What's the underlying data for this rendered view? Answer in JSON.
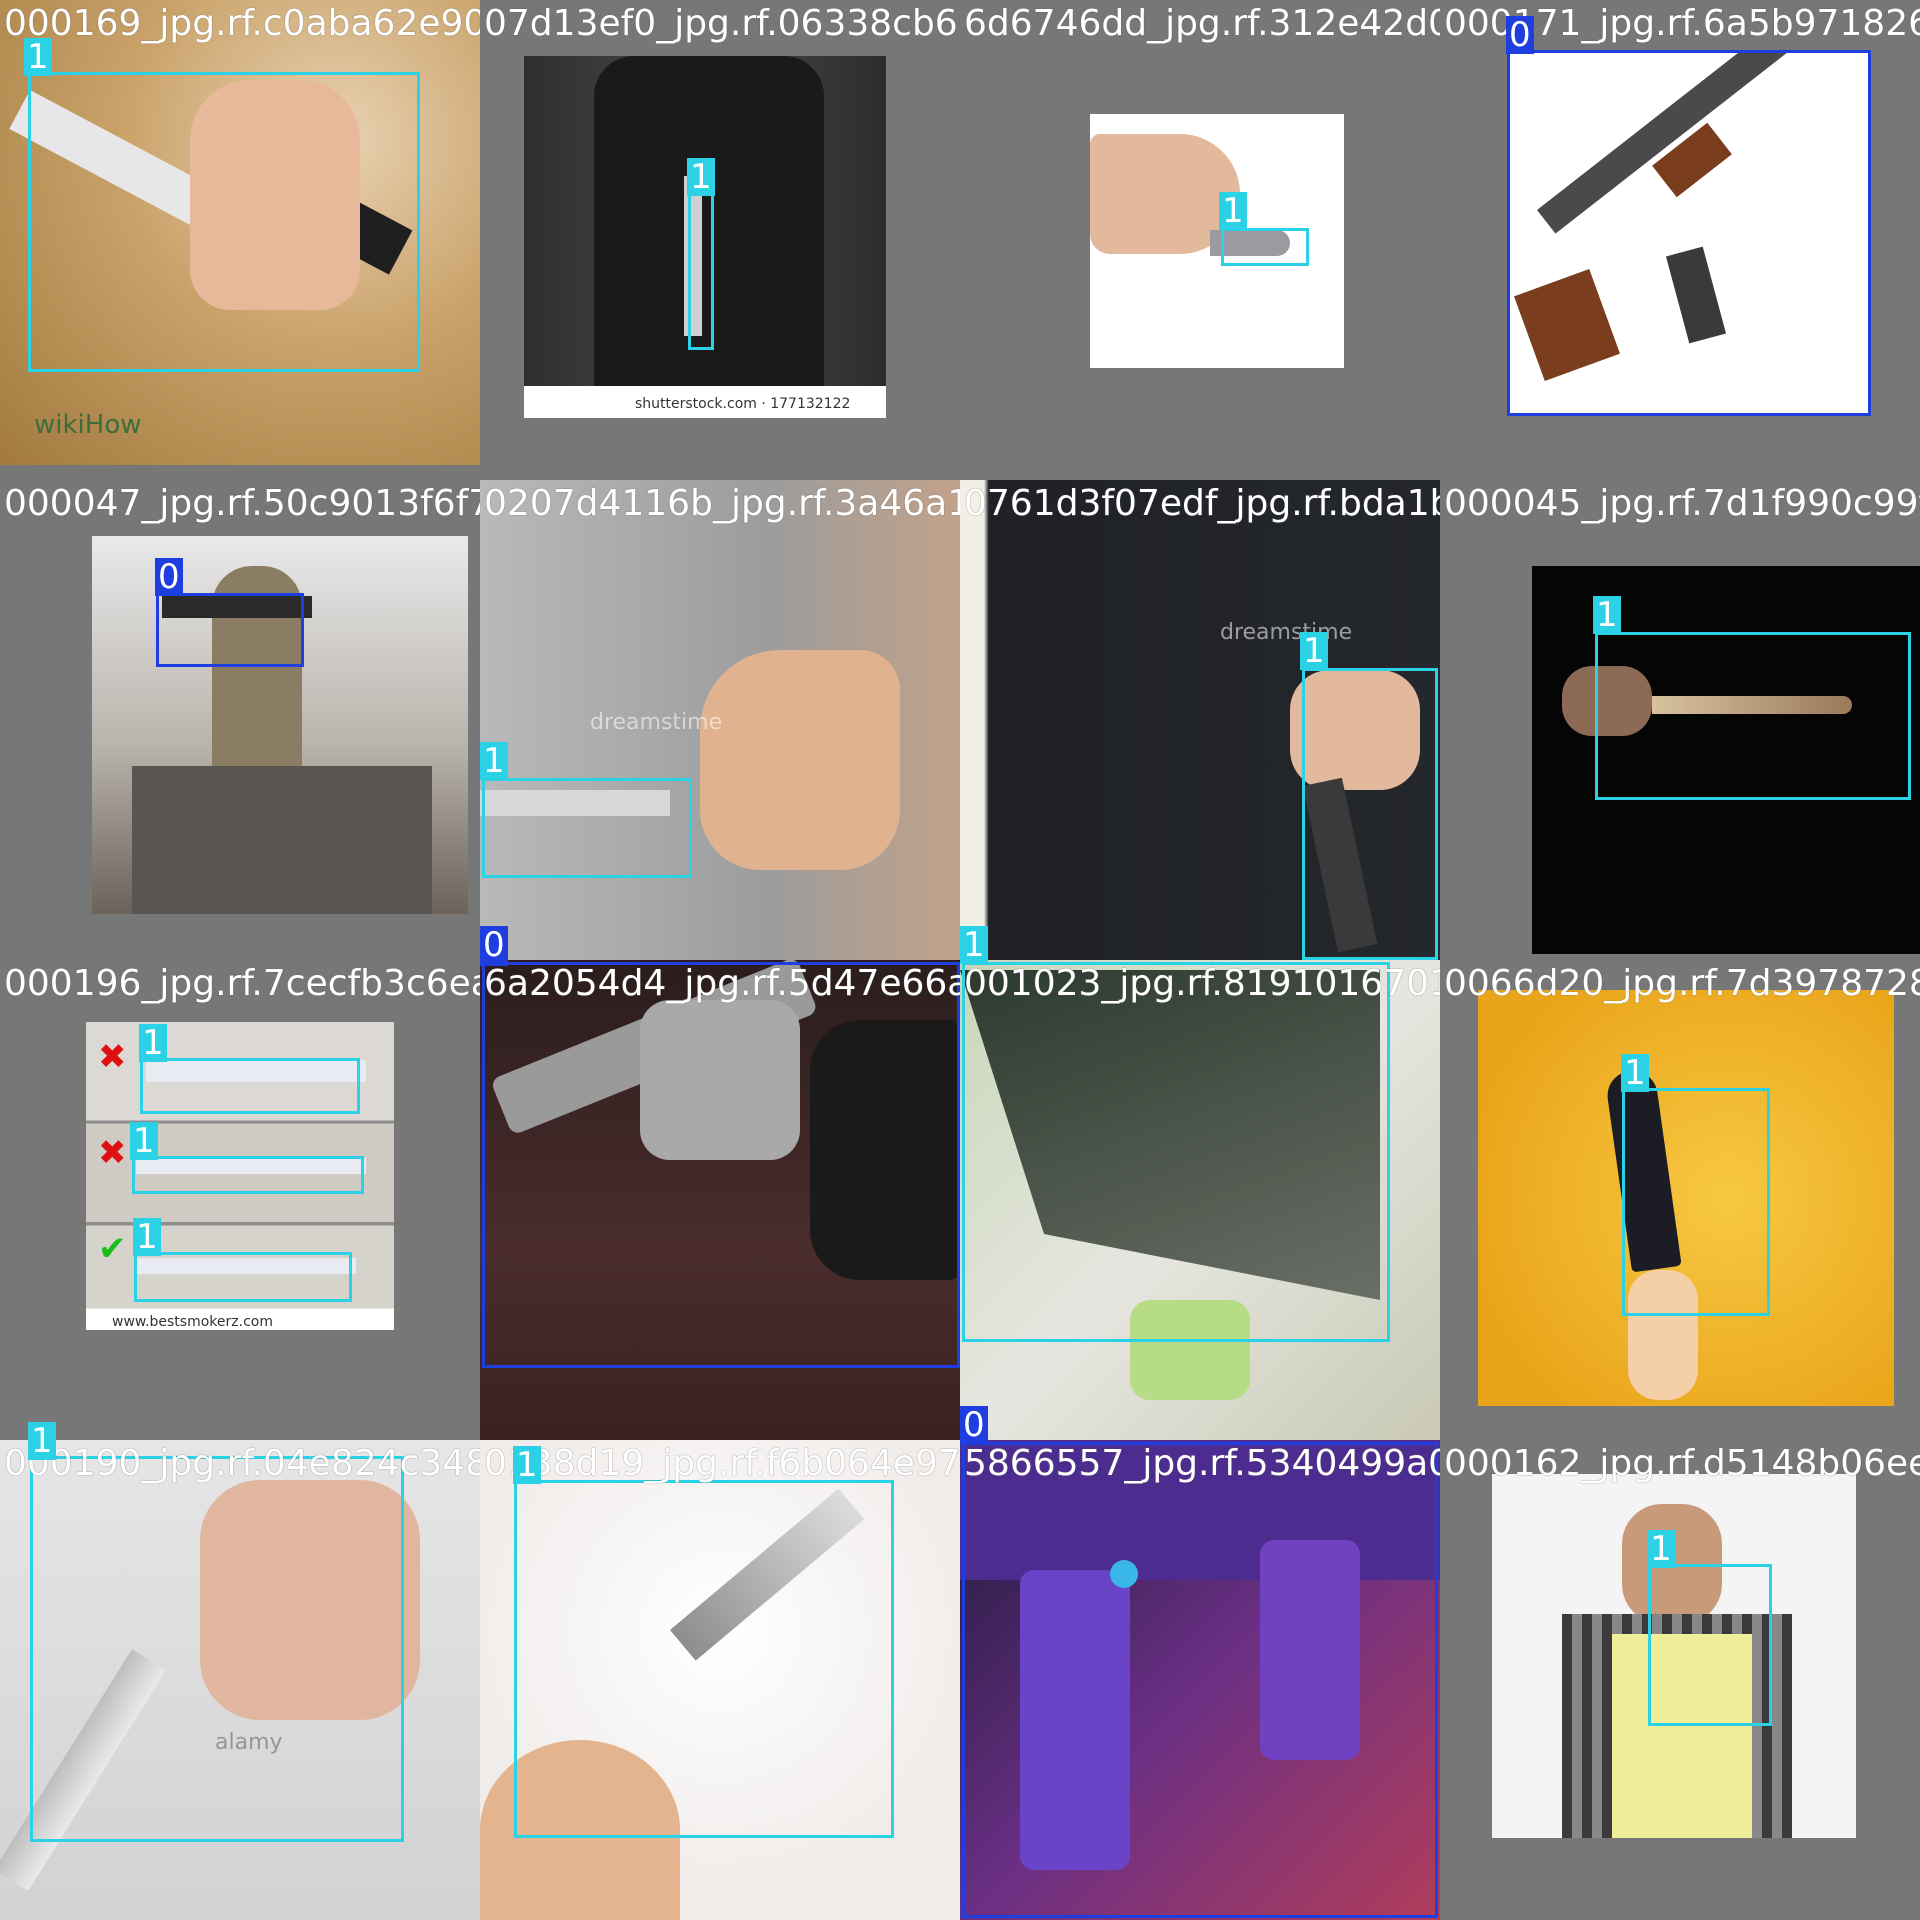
{
  "grid": {
    "tiles": [
      {
        "filename": "000169_jpg.rf.c0aba62e90f1",
        "labels": [
          "1"
        ],
        "watermark": "wikiHow"
      },
      {
        "filename": "07d13ef0_jpg.rf.06338cb60fb2",
        "labels": [
          "1"
        ],
        "caption": "shutterstock.com · 177132122"
      },
      {
        "filename": "6d6746dd_jpg.rf.312e42d0e585",
        "labels": [
          "1"
        ]
      },
      {
        "filename": "000171_jpg.rf.6a5b971826e",
        "labels": [
          "0"
        ]
      },
      {
        "filename": "000047_jpg.rf.50c9013f6f76",
        "labels": [
          "0"
        ]
      },
      {
        "filename": "0207d4116b_jpg.rf.3a46a17d4e",
        "labels": [
          "1"
        ],
        "watermark": "dreamstime"
      },
      {
        "filename": "0761d3f07edf_jpg.rf.bda1bd4eea",
        "labels": [
          "1"
        ],
        "watermark": "dreamstime"
      },
      {
        "filename": "000045_jpg.rf.7d1f990c99f625",
        "labels": [
          "1"
        ]
      },
      {
        "filename": "000196_jpg.rf.7cecfb3c6ea0",
        "labels": [
          "1",
          "1",
          "1"
        ],
        "caption": "www.bestsmokerz.com"
      },
      {
        "filename": "6a2054d4_jpg.rf.5d47e66a3c",
        "labels": [
          "0"
        ]
      },
      {
        "filename": "001023_jpg.rf.8191016701de",
        "labels": [
          "1"
        ]
      },
      {
        "filename": "0066d20_jpg.rf.7d39787282e",
        "labels": [
          "1"
        ]
      },
      {
        "filename": "000190_jpg.rf.04e824c348e",
        "labels": [
          "1"
        ],
        "watermark": "alamy"
      },
      {
        "filename": "0138d19_jpg.rf.f6b064e97b2",
        "labels": [
          "1"
        ]
      },
      {
        "filename": "5866557_jpg.rf.5340499a03",
        "labels": [
          "0"
        ]
      },
      {
        "filename": "000162_jpg.rf.d5148b06ee8b",
        "labels": [
          "1"
        ]
      }
    ]
  },
  "colors": {
    "class_0": "#1f3ee0",
    "class_1": "#2bd2e6",
    "background": "#777777"
  }
}
